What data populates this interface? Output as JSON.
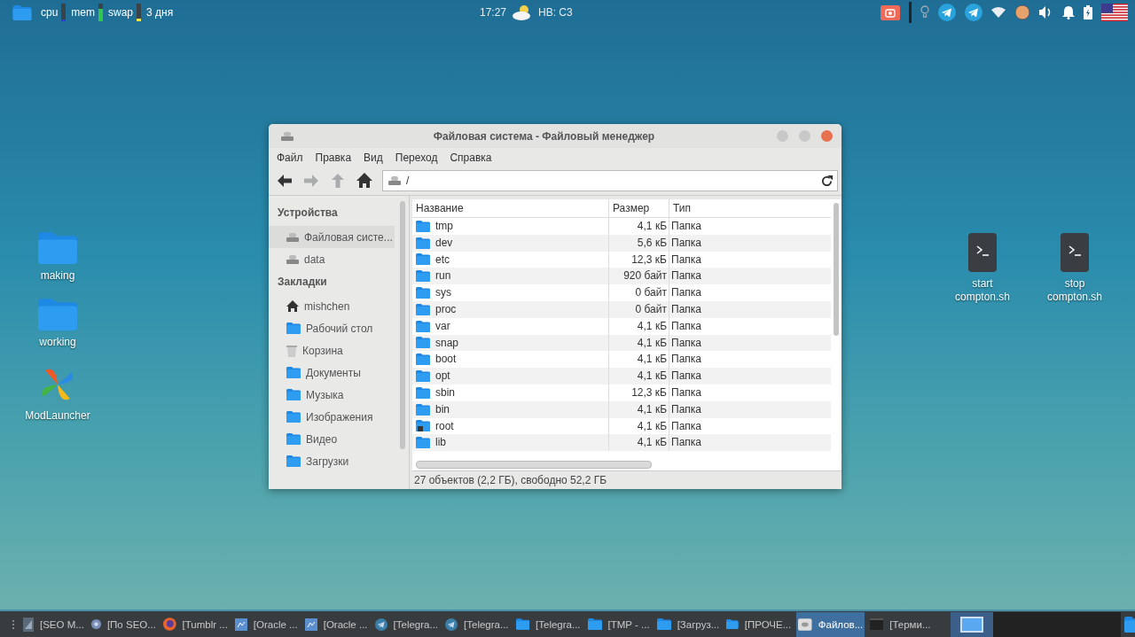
{
  "top_panel": {
    "meters": [
      {
        "label": "cpu",
        "level": 0.08
      },
      {
        "label": "mem",
        "level": 0.7
      },
      {
        "label": "swap",
        "level": 0.15
      }
    ],
    "uptime": "3 дня",
    "clock": "17:27",
    "weather": "НВ: С3"
  },
  "desktop_icons": [
    {
      "kind": "folder",
      "label": "making"
    },
    {
      "kind": "folder",
      "label": "working"
    },
    {
      "kind": "app",
      "label": "ModLauncher"
    },
    {
      "kind": "script",
      "label": "start compton.sh"
    },
    {
      "kind": "script",
      "label": "stop compton.sh"
    }
  ],
  "window": {
    "title": "Файловая система - Файловый менеджер",
    "menu": [
      "Файл",
      "Правка",
      "Вид",
      "Переход",
      "Справка"
    ],
    "toolbar": [
      {
        "kind": "back",
        "disabled": false
      },
      {
        "kind": "forward",
        "disabled": true
      },
      {
        "kind": "up",
        "disabled": true
      },
      {
        "kind": "home",
        "disabled": false
      }
    ],
    "location": "/",
    "sidebar": [
      {
        "heading": "Устройства",
        "items": [
          {
            "kind": "drive",
            "label": "Файловая систе...",
            "selected": true
          },
          {
            "kind": "drive",
            "label": "data",
            "selected": false
          }
        ]
      },
      {
        "heading": "Закладки",
        "items": [
          {
            "kind": "home",
            "label": "mishchen",
            "selected": false
          },
          {
            "kind": "folder",
            "label": "Рабочий стол",
            "selected": false
          },
          {
            "kind": "trash",
            "label": "Корзина",
            "selected": false
          },
          {
            "kind": "folder",
            "label": "Документы",
            "selected": false
          },
          {
            "kind": "folder",
            "label": "Музыка",
            "selected": false
          },
          {
            "kind": "folder",
            "label": "Изображения",
            "selected": false
          },
          {
            "kind": "folder",
            "label": "Видео",
            "selected": false
          },
          {
            "kind": "folder",
            "label": "Загрузки",
            "selected": false
          }
        ]
      }
    ],
    "columns": [
      "Название",
      "Размер",
      "Тип"
    ],
    "rows": [
      {
        "name": "tmp",
        "size": "4,1 кБ",
        "type": "Папка",
        "locked": false
      },
      {
        "name": "dev",
        "size": "5,6 кБ",
        "type": "Папка",
        "locked": false
      },
      {
        "name": "etc",
        "size": "12,3 кБ",
        "type": "Папка",
        "locked": false
      },
      {
        "name": "run",
        "size": "920 байт",
        "type": "Папка",
        "locked": false
      },
      {
        "name": "sys",
        "size": "0 байт",
        "type": "Папка",
        "locked": false
      },
      {
        "name": "proc",
        "size": "0 байт",
        "type": "Папка",
        "locked": false
      },
      {
        "name": "var",
        "size": "4,1 кБ",
        "type": "Папка",
        "locked": false
      },
      {
        "name": "snap",
        "size": "4,1 кБ",
        "type": "Папка",
        "locked": false
      },
      {
        "name": "boot",
        "size": "4,1 кБ",
        "type": "Папка",
        "locked": false
      },
      {
        "name": "opt",
        "size": "4,1 кБ",
        "type": "Папка",
        "locked": false
      },
      {
        "name": "sbin",
        "size": "12,3 кБ",
        "type": "Папка",
        "locked": false
      },
      {
        "name": "bin",
        "size": "4,1 кБ",
        "type": "Папка",
        "locked": false
      },
      {
        "name": "root",
        "size": "4,1 кБ",
        "type": "Папка",
        "locked": true
      },
      {
        "name": "lib",
        "size": "4,1 кБ",
        "type": "Папка",
        "locked": false
      }
    ],
    "status": "27 объектов (2,2 ГБ), свободно 52,2 ГБ"
  },
  "taskbar": {
    "tasks": [
      {
        "kind": "app",
        "label": "[SEO M...",
        "selected": false
      },
      {
        "kind": "browser",
        "label": "[По SEO...",
        "selected": false
      },
      {
        "kind": "firefox",
        "label": "[Tumblr ...",
        "selected": false
      },
      {
        "kind": "vm",
        "label": "[Oracle ...",
        "selected": false
      },
      {
        "kind": "vm",
        "label": "[Oracle ...",
        "selected": false
      },
      {
        "kind": "telegram",
        "label": "[Telegra...",
        "selected": false
      },
      {
        "kind": "telegram",
        "label": "[Telegra...",
        "selected": false
      },
      {
        "kind": "folder",
        "label": "[Telegra...",
        "selected": false
      },
      {
        "kind": "folder",
        "label": "[TMP - ...",
        "selected": false
      },
      {
        "kind": "folder",
        "label": "[Загруз...",
        "selected": false
      },
      {
        "kind": "folder",
        "label": "[ПРОЧЕ...",
        "selected": false
      },
      {
        "kind": "drive",
        "label": "Файлов...",
        "selected": true
      },
      {
        "kind": "terminal",
        "label": "[Терми...",
        "selected": false
      }
    ],
    "workspaces": [
      {
        "selected": true
      },
      {
        "selected": false
      },
      {
        "selected": false
      },
      {
        "selected": false
      }
    ]
  }
}
